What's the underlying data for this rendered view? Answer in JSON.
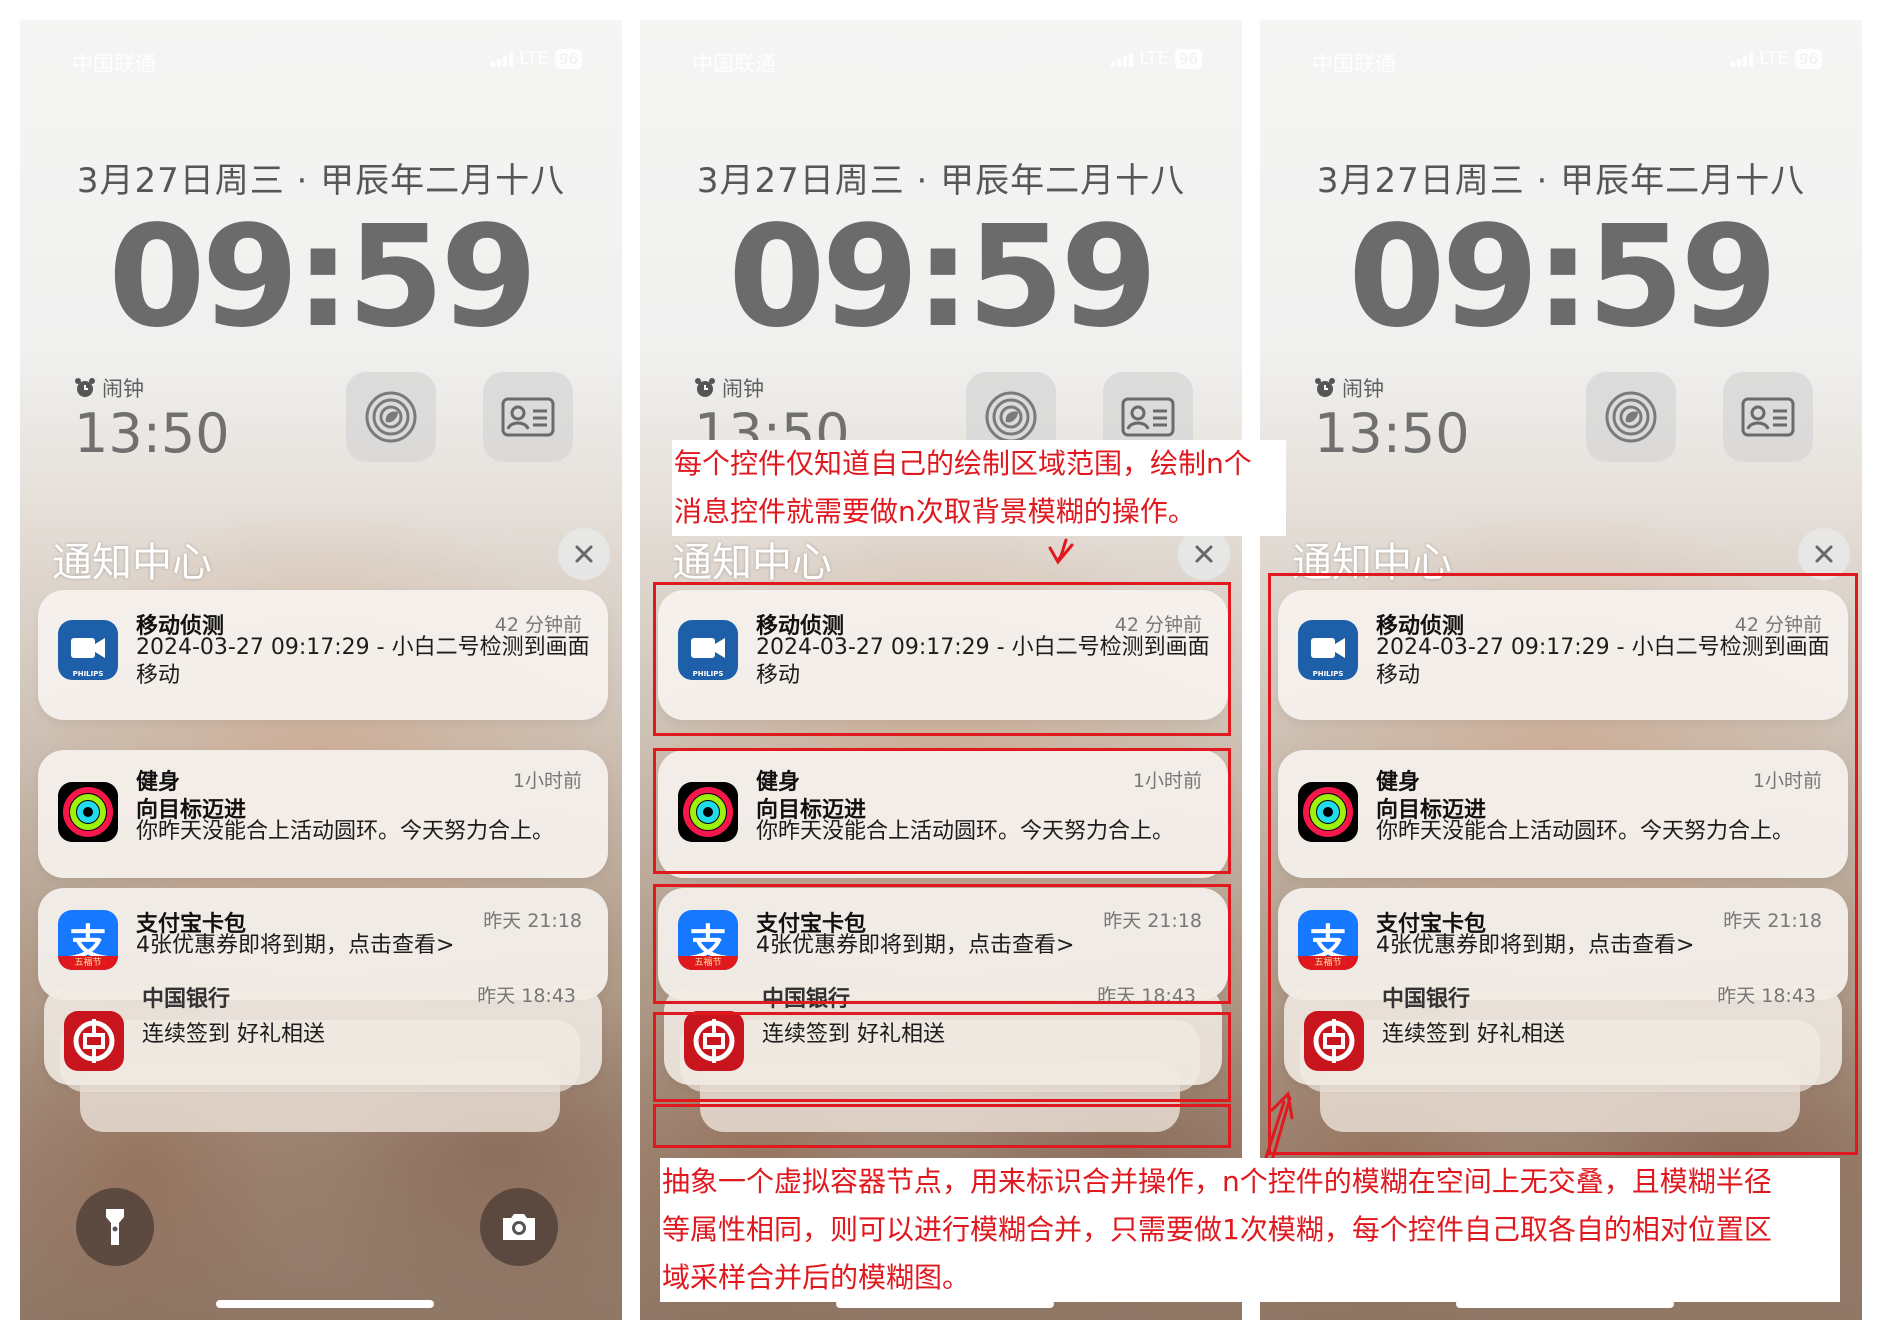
{
  "status_bar": {
    "carrier": "中国联通",
    "network": "LTE",
    "battery": "96"
  },
  "lock": {
    "date": "3月27日周三 · 甲辰年二月十八",
    "time": "09:59",
    "alarm_label": "闹钟",
    "alarm_time": "13:50"
  },
  "notification_center": {
    "title": "通知中心"
  },
  "notifications": [
    {
      "app": "PHILIPS",
      "title": "移动侦测",
      "time": "42 分钟前",
      "body": "2024-03-27 09:17:29 - 小白二号检测到画面移动"
    },
    {
      "app": "fitness",
      "title": "健身",
      "time": "1小时前",
      "subtitle": "向目标迈进",
      "body": "你昨天没能合上活动圆环。今天努力合上。"
    },
    {
      "app": "五福节",
      "title": "支付宝卡包",
      "time": "昨天 21:18",
      "body": "4张优惠券即将到期，点击查看>"
    },
    {
      "app": "bank",
      "title": "中国银行",
      "time": "昨天 18:43",
      "body": "连续签到 好礼相送"
    }
  ],
  "annotations": {
    "top_note_line1": "每个控件仅知道自己的绘制区域范围，绘制n个",
    "top_note_line2": "消息控件就需要做n次取背景模糊的操作。",
    "bottom_note_line1": "抽象一个虚拟容器节点，用来标识合并操作，n个控件的模糊在空间上无交叠，且模糊半径",
    "bottom_note_line2": "等属性相同，则可以进行模糊合并，只需要做1次模糊，每个控件自己取各自的相对位置区",
    "bottom_note_line3": "域采样合并后的模糊图。"
  },
  "colors": {
    "annotation_red": "#e0191f"
  },
  "icons": [
    "flashlight-icon",
    "camera-icon",
    "alarm-clock-icon",
    "close-icon",
    "shazam-icon",
    "id-card-icon"
  ]
}
